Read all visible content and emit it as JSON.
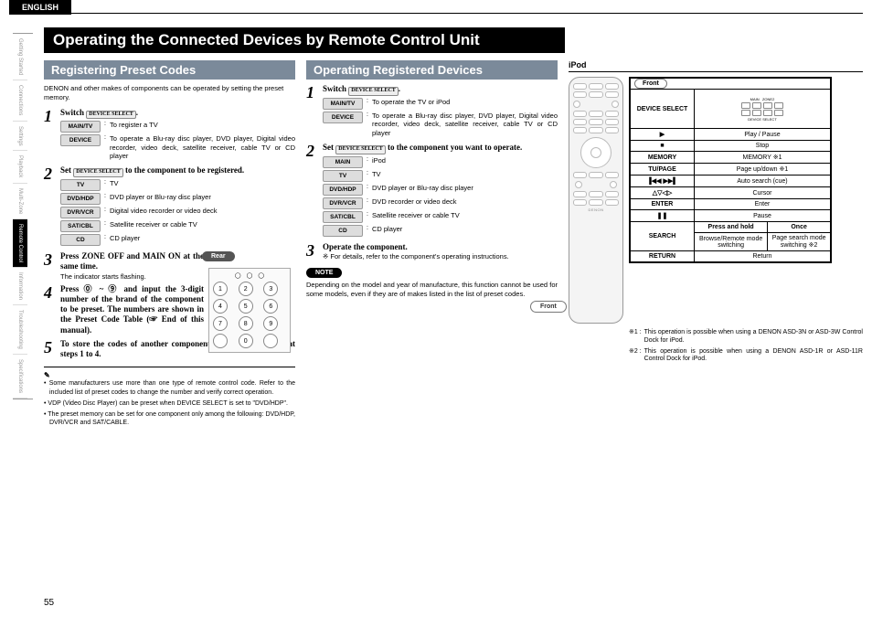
{
  "language": "ENGLISH",
  "page_number": "55",
  "sidebar": {
    "items": [
      {
        "label": "Getting Started"
      },
      {
        "label": "Connections"
      },
      {
        "label": "Settings"
      },
      {
        "label": "Playback"
      },
      {
        "label": "Multi-Zone"
      },
      {
        "label": "Remote Control"
      },
      {
        "label": "Information"
      },
      {
        "label": "Troubleshooting"
      },
      {
        "label": "Specifications"
      }
    ],
    "active_index": 5
  },
  "title": "Operating the Connected Devices by Remote Control Unit",
  "registering": {
    "heading": "Registering Preset Codes",
    "intro": "DENON and other makes of components can be operated by setting the preset memory.",
    "step1": {
      "lead_prefix": "Switch",
      "lead_suffix": ".",
      "device_select_label": "DEVICE SELECT",
      "rows": [
        {
          "k": "MAIN/TV",
          "v": "To register a TV"
        },
        {
          "k": "DEVICE",
          "v": "To operate a Blu-ray disc player, DVD player, Digital video recorder, video deck, satellite receiver, cable TV or CD player"
        }
      ]
    },
    "step2": {
      "lead_prefix": "Set",
      "lead_suffix": "to the component to be registered.",
      "device_select_label": "DEVICE SELECT",
      "rows": [
        {
          "k": "TV",
          "v": "TV"
        },
        {
          "k": "DVD/HDP",
          "v": "DVD player or Blu-ray disc player"
        },
        {
          "k": "DVR/VCR",
          "v": "Digital video recorder or video deck"
        },
        {
          "k": "SAT/CBL",
          "v": "Satellite receiver or cable TV"
        },
        {
          "k": "CD",
          "v": "CD player"
        }
      ]
    },
    "step3": {
      "lead": "Press  ZONE OFF  and  MAIN ON  at the same time.",
      "sub": "The indicator starts flashing.",
      "rear_label": "Rear"
    },
    "step4": {
      "lead": "Press ⓪ ~ ⑨ and input the 3-digit number of the brand of the component to be preset. The numbers are shown in the Preset Code Table (☞ End of this manual)."
    },
    "step5": {
      "lead": "To store the codes of another component in the memory, repeat steps 1 to 4."
    },
    "notes": [
      "Some manufacturers use more than one type of remote control code. Refer to the included list of preset codes to change the number and verify correct operation.",
      "VDP (Video Disc Player) can be preset when DEVICE SELECT is set to \"DVD/HDP\".",
      "The preset memory can be set for one component only among the following: DVD/HDP, DVR/VCR and SAT/CABLE."
    ]
  },
  "operating": {
    "heading": "Operating Registered Devices",
    "step1": {
      "lead_prefix": "Switch",
      "lead_suffix": ".",
      "device_select_label": "DEVICE SELECT",
      "rows": [
        {
          "k": "MAIN/TV",
          "v": "To operate the TV or iPod"
        },
        {
          "k": "DEVICE",
          "v": "To operate a Blu-ray disc player, DVD player, Digital video recorder, video deck, satellite receiver, cable TV or CD player"
        }
      ]
    },
    "step2": {
      "lead_prefix": "Set",
      "lead_suffix": "to the component you want to operate.",
      "device_select_label": "DEVICE SELECT",
      "rows": [
        {
          "k": "MAIN",
          "v": "iPod"
        },
        {
          "k": "TV",
          "v": "TV"
        },
        {
          "k": "DVD/HDP",
          "v": "DVD player or Blu-ray disc player"
        },
        {
          "k": "DVR/VCR",
          "v": "DVD recorder or video deck"
        },
        {
          "k": "SAT/CBL",
          "v": "Satellite receiver or cable TV"
        },
        {
          "k": "CD",
          "v": "CD player"
        }
      ]
    },
    "step3": {
      "lead": "Operate the component.",
      "sub": "※ For details, refer to the component's operating instructions."
    },
    "note_label": "NOTE",
    "note_body": "Depending on the model and year of manufacture, this function cannot be used for some models, even if they are of makes listed in the list of preset codes."
  },
  "ipod": {
    "heading": "iPod",
    "front_label": "Front",
    "table_front_label": "Front",
    "device_select_label": "DEVICE SELECT",
    "logo": "DENON",
    "rows": [
      {
        "k": "DEVICE SELECT",
        "v_type": "graphic"
      },
      {
        "k": "▶",
        "v": "Play / Pause"
      },
      {
        "k": "■",
        "v": "Stop"
      },
      {
        "k": "MEMORY",
        "v": "MEMORY ※1"
      },
      {
        "k": "TU/PAGE",
        "v": "Page up/down ※1"
      },
      {
        "k": "▐◀◀ ▶▶▌",
        "v": "Auto search (cue)"
      },
      {
        "k": "△▽◁▷",
        "v": "Cursor"
      },
      {
        "k": "ENTER",
        "v": "Enter"
      },
      {
        "k": "❚❚",
        "v": "Pause"
      }
    ],
    "search": {
      "k": "SEARCH",
      "h1": "Press and hold",
      "h2": "Once",
      "v1": "Browse/Remote mode switching",
      "v2": "Page search mode switching ※2"
    },
    "return_row": {
      "k": "RETURN",
      "v": "Return"
    },
    "footnotes": [
      {
        "m": "※1 :",
        "t": "This operation is possible when using a DENON ASD-3N or ASD-3W Control Dock for iPod."
      },
      {
        "m": "※2 :",
        "t": "This operation is possible when using a DENON ASD-1R or ASD-11R Control Dock for iPod."
      }
    ]
  }
}
